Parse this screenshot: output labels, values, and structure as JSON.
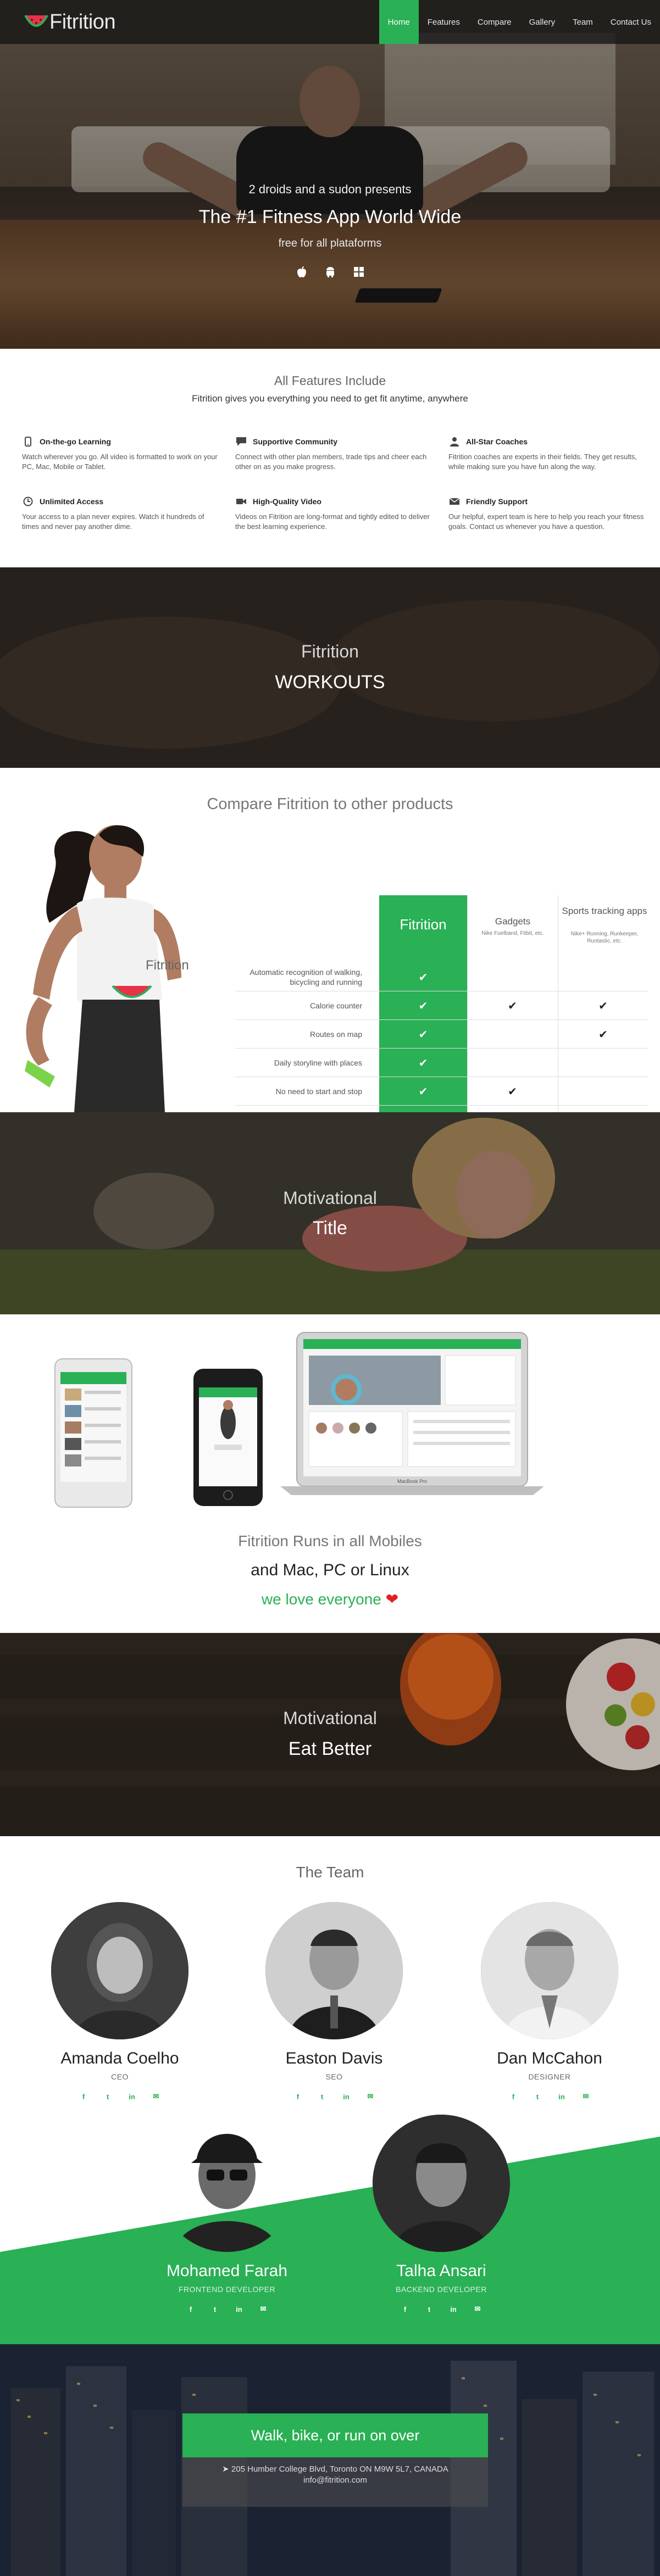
{
  "brand": {
    "name": "Fitrition",
    "logo_icon": "watermelon-icon"
  },
  "nav": {
    "items": [
      {
        "label": "Home",
        "active": true
      },
      {
        "label": "Features"
      },
      {
        "label": "Compare"
      },
      {
        "label": "Gallery"
      },
      {
        "label": "Team"
      },
      {
        "label": "Contact Us"
      }
    ]
  },
  "hero": {
    "subtitle": "2 droids and a sudon presents",
    "title": "The #1 Fitness App World Wide",
    "free_text": "free for all plataforms",
    "platform_icons": [
      "apple-icon",
      "android-icon",
      "windows-icon"
    ]
  },
  "features": {
    "title": "All Features Include",
    "subtitle": "Fitrition gives you everything you need to get fit anytime, anywhere",
    "items": [
      {
        "icon": "mobile-icon",
        "title": "On-the-go Learning",
        "text": "Watch wherever you go. All video is formatted to work on your PC, Mac, Mobile or Tablet."
      },
      {
        "icon": "chat-icon",
        "title": "Supportive Community",
        "text": "Connect with other plan members, trade tips and cheer each other on as you make progress."
      },
      {
        "icon": "user-icon",
        "title": "All-Star Coaches",
        "text": "Fitrition coaches are experts in their fields. They get results, while making sure you have fun along the way."
      },
      {
        "icon": "clock-icon",
        "title": "Unlimited Access",
        "text": "Your access to a plan never expires. Watch it hundreds of times and never pay another dime."
      },
      {
        "icon": "video-icon",
        "title": "High-Quality Video",
        "text": "Videos on Fitrition are long-format and tightly edited to deliver the best learning experience."
      },
      {
        "icon": "envelope-icon",
        "title": "Friendly Support",
        "text": "Our helpful, expert team is here to help you reach your fitness goals. Contact us whenever you have a question."
      }
    ]
  },
  "workouts": {
    "small": "Fitrition",
    "large": "WORKOUTS"
  },
  "compare": {
    "title": "Compare Fitrition to other products",
    "columns": [
      {
        "name": "Fitrition",
        "sub": ""
      },
      {
        "name": "Gadgets",
        "sub": "Nike Fuelband, Fitbit, etc."
      },
      {
        "name": "Sports tracking apps",
        "sub": "Nike+ Running, Runkeeper, Runtastic, etc."
      }
    ],
    "rows": [
      {
        "label": "Automatic recognition of walking, bicycling and running",
        "checks": [
          true,
          false,
          false
        ]
      },
      {
        "label": "Calorie counter",
        "checks": [
          true,
          true,
          true
        ]
      },
      {
        "label": "Routes on map",
        "checks": [
          true,
          false,
          true
        ]
      },
      {
        "label": "Daily storyline with places",
        "checks": [
          true,
          false,
          false
        ]
      },
      {
        "label": "No need to start and stop",
        "checks": [
          true,
          true,
          false
        ]
      }
    ],
    "shirt_text": "Fitrition"
  },
  "motivational": {
    "small": "Motivational",
    "large": "Title"
  },
  "mobiles": {
    "line1": "Fitrition Runs in all Mobiles",
    "line2": "and Mac, PC or Linux",
    "line3": "we love everyone",
    "heart_icon": "heart-icon",
    "laptop_label": "MacBook Pro"
  },
  "eat": {
    "small": "Motivational",
    "large": "Eat Better"
  },
  "team": {
    "title": "The Team",
    "members": [
      {
        "name": "Amanda Coelho",
        "role": "CEO"
      },
      {
        "name": "Easton Davis",
        "role": "SEO"
      },
      {
        "name": "Dan McCahon",
        "role": "DESIGNER"
      },
      {
        "name": "Mohamed Farah",
        "role": "FRONTEND DEVELOPER"
      },
      {
        "name": "Talha Ansari",
        "role": "BACKEND DEVELOPER"
      }
    ],
    "social_icons": [
      "facebook-icon",
      "twitter-icon",
      "linkedin-icon",
      "email-icon"
    ]
  },
  "footer": {
    "headline": "Walk, bike, or run on over",
    "address": "205 Humber College Blvd, Toronto ON M9W 5L7, CANADA",
    "email": "info@fitrition.com"
  },
  "colors": {
    "accent": "#2ab055",
    "nav_bg": "#141414",
    "heart": "#e02020"
  }
}
